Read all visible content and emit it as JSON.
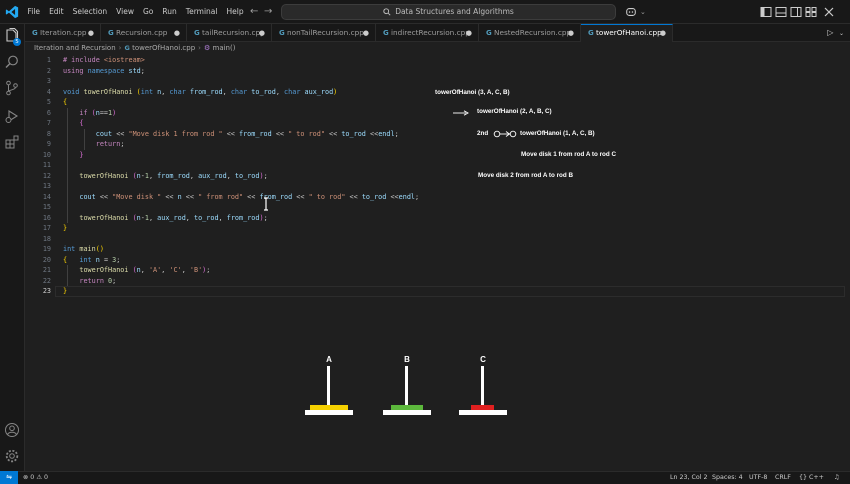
{
  "titlebar": {
    "menu": [
      "File",
      "Edit",
      "Selection",
      "View",
      "Go",
      "Run",
      "Terminal",
      "Help"
    ],
    "search_text": "Data Structures and Algorithms"
  },
  "tabs": [
    {
      "label": "Iteration.cpp",
      "active": false
    },
    {
      "label": "Recursion.cpp",
      "active": false
    },
    {
      "label": "tailRecursion.cpp",
      "active": false
    },
    {
      "label": "nonTailRecursion.cpp",
      "active": false
    },
    {
      "label": "indirectRecursion.cpp",
      "active": false
    },
    {
      "label": "NestedRecursion.cpp",
      "active": false
    },
    {
      "label": "towerOfHanoi.cpp",
      "active": true
    }
  ],
  "breadcrumb": {
    "folder": "Iteration and Recursion",
    "file": "towerOfHanoi.cpp",
    "symbol": "main()"
  },
  "editor": {
    "active_line": 23,
    "lines": [
      [
        [
          "pp",
          "# include "
        ],
        [
          "inc",
          "<iostream>"
        ]
      ],
      [
        [
          "ctl",
          "using "
        ],
        [
          "kw",
          "namespace "
        ],
        [
          "var",
          "std"
        ],
        [
          "",
          "; "
        ]
      ],
      [],
      [
        [
          "kw",
          "void "
        ],
        [
          "fn",
          "towerOfHanoi "
        ],
        [
          "br1",
          "("
        ],
        [
          "kw",
          "int "
        ],
        [
          "var",
          "n"
        ],
        [
          "",
          ", "
        ],
        [
          "kw",
          "char "
        ],
        [
          "var",
          "from_rod"
        ],
        [
          "",
          ", "
        ],
        [
          "kw",
          "char "
        ],
        [
          "var",
          "to_rod"
        ],
        [
          "",
          ", "
        ],
        [
          "kw",
          "char "
        ],
        [
          "var",
          "aux_rod"
        ],
        [
          "br1",
          ")"
        ]
      ],
      [
        [
          "br1",
          "{"
        ]
      ],
      [
        [
          "",
          "    "
        ],
        [
          "ctl",
          "if "
        ],
        [
          "br2",
          "("
        ],
        [
          "var",
          "n"
        ],
        [
          "",
          "=="
        ],
        [
          "num",
          "1"
        ],
        [
          "br2",
          ")"
        ]
      ],
      [
        [
          "",
          "    "
        ],
        [
          "br2",
          "{"
        ]
      ],
      [
        [
          "",
          "        "
        ],
        [
          "var",
          "cout "
        ],
        [
          "",
          "<< "
        ],
        [
          "str",
          "\"Move disk 1 from rod \""
        ],
        [
          "",
          " << "
        ],
        [
          "var",
          "from_rod"
        ],
        [
          "",
          " << "
        ],
        [
          "str",
          "\" to rod\""
        ],
        [
          "",
          " << "
        ],
        [
          "var",
          "to_rod"
        ],
        [
          "",
          " <<"
        ],
        [
          "var",
          "endl"
        ],
        [
          "",
          ";"
        ]
      ],
      [
        [
          "",
          "        "
        ],
        [
          "ctl",
          "return"
        ],
        [
          "",
          ";"
        ]
      ],
      [
        [
          "",
          "    "
        ],
        [
          "br2",
          "}"
        ]
      ],
      [],
      [
        [
          "",
          "    "
        ],
        [
          "fn",
          "towerOfHanoi "
        ],
        [
          "br2",
          "("
        ],
        [
          "var",
          "n"
        ],
        [
          "",
          "-"
        ],
        [
          "num",
          "1"
        ],
        [
          "",
          ", "
        ],
        [
          "var",
          "from_rod"
        ],
        [
          "",
          ", "
        ],
        [
          "var",
          "aux_rod"
        ],
        [
          "",
          ", "
        ],
        [
          "var",
          "to_rod"
        ],
        [
          "br2",
          ")"
        ],
        [
          "",
          ";"
        ]
      ],
      [],
      [
        [
          "",
          "    "
        ],
        [
          "var",
          "cout "
        ],
        [
          "",
          "<< "
        ],
        [
          "str",
          "\"Move disk \""
        ],
        [
          "",
          " << "
        ],
        [
          "var",
          "n"
        ],
        [
          "",
          " << "
        ],
        [
          "str",
          "\" from rod\""
        ],
        [
          "",
          " << "
        ],
        [
          "var",
          "from_rod"
        ],
        [
          "",
          " << "
        ],
        [
          "str",
          "\" to rod\""
        ],
        [
          "",
          " << "
        ],
        [
          "var",
          "to_rod"
        ],
        [
          "",
          " <<"
        ],
        [
          "var",
          "endl"
        ],
        [
          "",
          ";"
        ]
      ],
      [],
      [
        [
          "",
          "    "
        ],
        [
          "fn",
          "towerOfHanoi "
        ],
        [
          "br2",
          "("
        ],
        [
          "var",
          "n"
        ],
        [
          "",
          "-"
        ],
        [
          "num",
          "1"
        ],
        [
          "",
          ", "
        ],
        [
          "var",
          "aux_rod"
        ],
        [
          "",
          ", "
        ],
        [
          "var",
          "to_rod"
        ],
        [
          "",
          ", "
        ],
        [
          "var",
          "from_rod"
        ],
        [
          "br2",
          ")"
        ],
        [
          "",
          ";"
        ]
      ],
      [
        [
          "br1",
          "}"
        ]
      ],
      [],
      [
        [
          "kw",
          "int "
        ],
        [
          "fn",
          "main"
        ],
        [
          "br1",
          "()"
        ]
      ],
      [
        [
          "br1",
          "{"
        ],
        [
          "",
          "   "
        ],
        [
          "kw",
          "int "
        ],
        [
          "var",
          "n "
        ],
        [
          "",
          "= "
        ],
        [
          "num",
          "3"
        ],
        [
          "",
          ";"
        ]
      ],
      [
        [
          "",
          "    "
        ],
        [
          "fn",
          "towerOfHanoi "
        ],
        [
          "br2",
          "("
        ],
        [
          "var",
          "n"
        ],
        [
          "",
          ", "
        ],
        [
          "str",
          "'A'"
        ],
        [
          "",
          ", "
        ],
        [
          "str",
          "'C'"
        ],
        [
          "",
          ", "
        ],
        [
          "str",
          "'B'"
        ],
        [
          "br2",
          ")"
        ],
        [
          "",
          ";"
        ]
      ],
      [
        [
          "",
          "    "
        ],
        [
          "ctl",
          "return "
        ],
        [
          "num",
          "0"
        ],
        [
          "",
          ";"
        ]
      ],
      [
        [
          "br1",
          "}"
        ]
      ]
    ]
  },
  "annotations": {
    "call_root": "towerOfHanoi (3, A, C, B)",
    "call_level2": "towerOfHanoi (2, A, B, C)",
    "second_label": "2nd",
    "call_level3": "towerOfHanoi (1, A, C, B)",
    "move1": "Move disk 1 from rod A to rod C",
    "move2": "Move disk 2 from rod A to rod B"
  },
  "hanoi": {
    "pegs": [
      {
        "label": "A",
        "disk_color": "#f5d000"
      },
      {
        "label": "B",
        "disk_color": "#5cb83c"
      },
      {
        "label": "C",
        "disk_color": "#e02020"
      }
    ]
  },
  "statusbar": {
    "errors": "0",
    "warnings": "0",
    "position": "Ln 23, Col 2",
    "spaces": "Spaces: 4",
    "encoding": "UTF-8",
    "eol": "CRLF",
    "language": "C++"
  },
  "colors": {
    "accent": "#0078d4",
    "editor_bg": "#1f1f1f"
  }
}
